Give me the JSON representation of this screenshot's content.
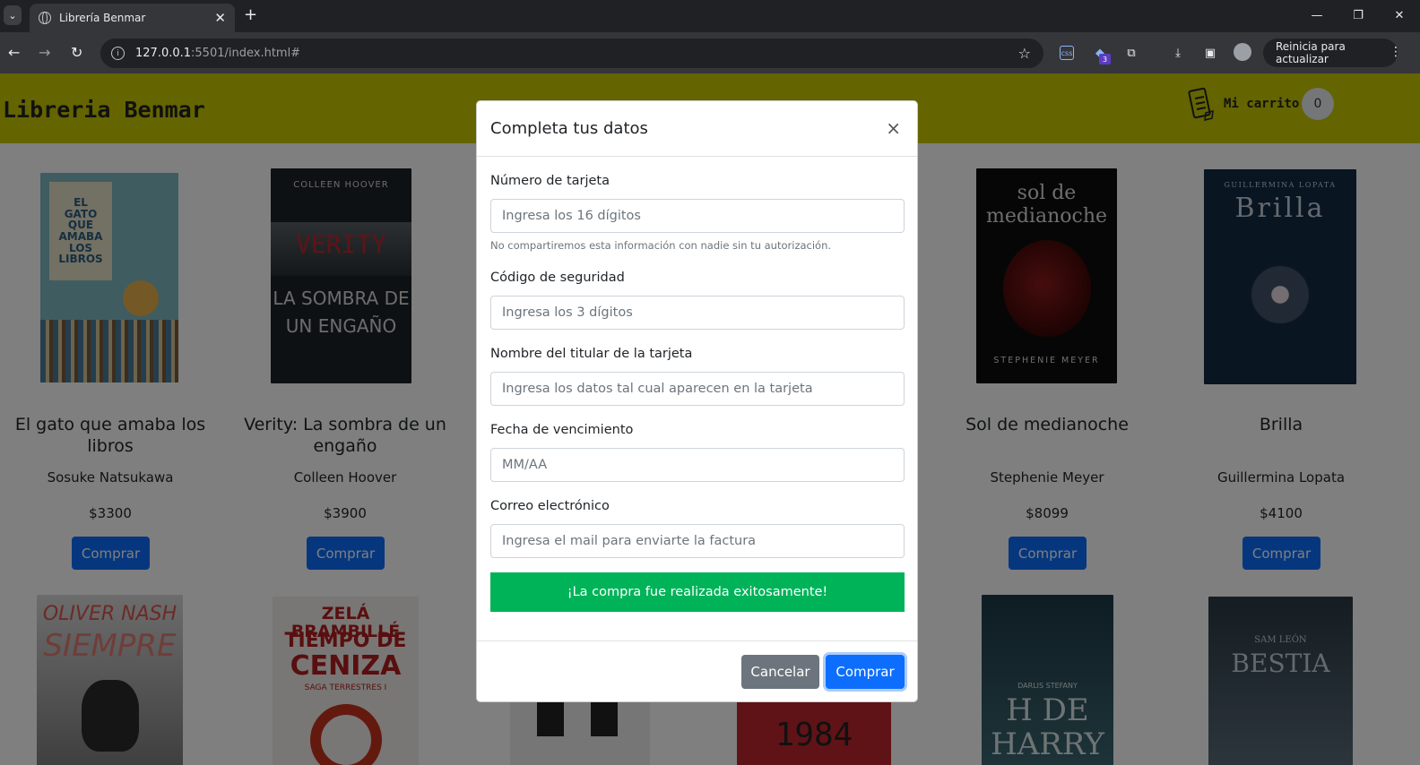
{
  "browser": {
    "tab_title": "Librería Benmar",
    "url_host": "127.0.0.1",
    "url_rest": ":5501/index.html#",
    "update_label": "Reinicia para actualizar",
    "extension_badge": "3"
  },
  "header": {
    "brand": "Libreria Benmar",
    "cart_label": "Mi carrito",
    "cart_count": "0",
    "background_color": "#c8c800"
  },
  "books": [
    {
      "title": "El gato que amaba los libros",
      "author": "Sosuke Natsukawa",
      "price": "$3300",
      "buy_label": "Comprar",
      "cover_lines": [
        "EL",
        "GATO",
        "QUE",
        "AMABA",
        "LOS",
        "LIBROS"
      ]
    },
    {
      "title": "Verity: La sombra de un engaño",
      "author": "Colleen Hoover",
      "price": "$3900",
      "buy_label": "Comprar",
      "cover_lines": [
        "COLLEEN HOOVER",
        "VERITY",
        "LA SOMBRA DE",
        "UN ENGAÑO"
      ]
    },
    {
      "title": "Sol de medianoche",
      "author": "Stephenie Meyer",
      "price": "$8099",
      "buy_label": "Comprar",
      "cover_lines": [
        "sol de",
        "medianoche",
        "STEPHENIE MEYER"
      ]
    },
    {
      "title": "Brilla",
      "author": "Guillermina Lopata",
      "price": "$4100",
      "buy_label": "Comprar",
      "cover_lines": [
        "GUILLERMINA LOPATA",
        "Brilla"
      ]
    }
  ],
  "second_row_covers": [
    [
      "OLIVER NASH",
      "SIEMPRE"
    ],
    [
      "ZELÁ BRAMBILLÉ",
      "TIEMPO DE",
      "CENIZA",
      "SAGA TERRESTRES I"
    ],
    [],
    [
      "1984"
    ],
    [
      "DARLIS STEFANY",
      "H DE",
      "HARRY"
    ],
    [
      "SAM LEÓN",
      "BESTIA"
    ]
  ],
  "modal": {
    "title": "Completa tus datos",
    "close": "×",
    "card_number": {
      "label": "Número de tarjeta",
      "placeholder": "Ingresa los 16 dígitos",
      "help": "No compartiremos esta información con nadie sin tu autorización."
    },
    "security_code": {
      "label": "Código de seguridad",
      "placeholder": "Ingresa los 3 dígitos"
    },
    "holder_name": {
      "label": "Nombre del titular de la tarjeta",
      "placeholder": "Ingresa los datos tal cual aparecen en la tarjeta"
    },
    "expiry": {
      "label": "Fecha de vencimiento",
      "placeholder": "MM/AA"
    },
    "email": {
      "label": "Correo electrónico",
      "placeholder": "Ingresa el mail para enviarte la factura"
    },
    "success_message": "¡La compra fue realizada exitosamente!",
    "cancel_label": "Cancelar",
    "buy_label": "Comprar",
    "success_color": "#00b359",
    "primary_color": "#0d6efd"
  }
}
